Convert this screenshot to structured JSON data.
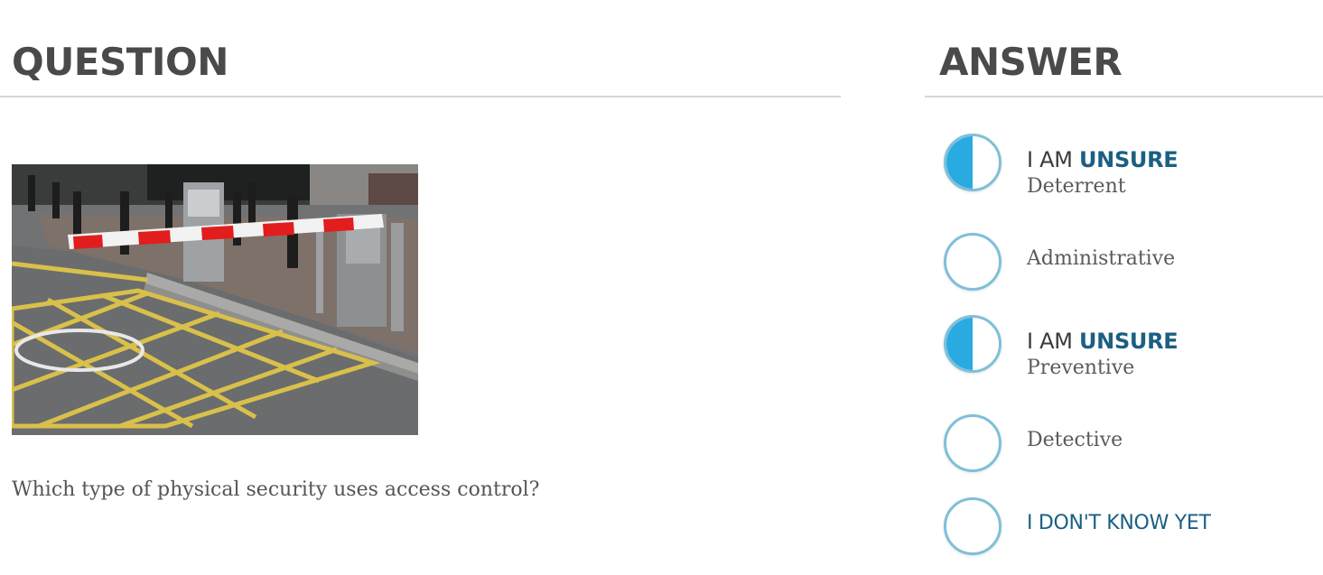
{
  "question": {
    "heading": "QUESTION",
    "text": "Which type of physical security uses access control?"
  },
  "answer": {
    "heading": "ANSWER",
    "options": [
      {
        "status_prefix": "I AM ",
        "status_emphasis": "UNSURE",
        "label": "Deterrent",
        "state": "unsure"
      },
      {
        "label": "Administrative",
        "state": "empty"
      },
      {
        "status_prefix": "I AM ",
        "status_emphasis": "UNSURE",
        "label": "Preventive",
        "state": "unsure"
      },
      {
        "label": "Detective",
        "state": "empty"
      },
      {
        "label": "I DON'T KNOW YET",
        "state": "empty"
      }
    ]
  },
  "colors": {
    "accent": "#29abe2",
    "ring": "#7fbfd9",
    "emphasis": "#1b5f83",
    "heading": "#4a4a4a"
  }
}
